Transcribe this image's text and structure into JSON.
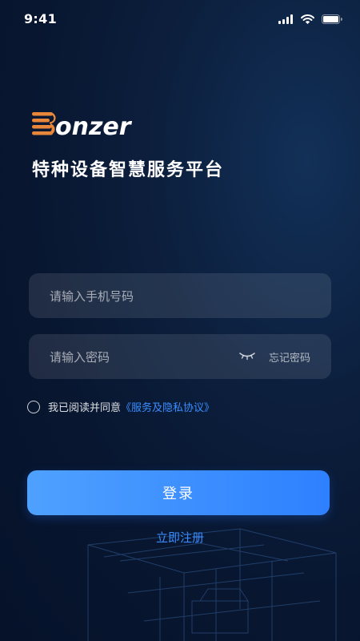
{
  "status_bar": {
    "time": "9:41",
    "icons": [
      "cellular-signal-icon",
      "wifi-icon",
      "battery-icon"
    ]
  },
  "brand": {
    "logo_text": "onzer",
    "subtitle": "特种设备智慧服务平台",
    "logo_color": "#e8873a"
  },
  "login_form": {
    "phone_placeholder": "请输入手机号码",
    "password_placeholder": "请输入密码",
    "forgot_password": "忘记密码",
    "agreement_text": "我已阅读并同意",
    "agreement_link": "《服务及隐私协议》",
    "login_button": "登录",
    "register_link": "立即注册"
  },
  "colors": {
    "background": "#0a1a36",
    "accent": "#2e80ff",
    "link": "#3a8dff"
  }
}
